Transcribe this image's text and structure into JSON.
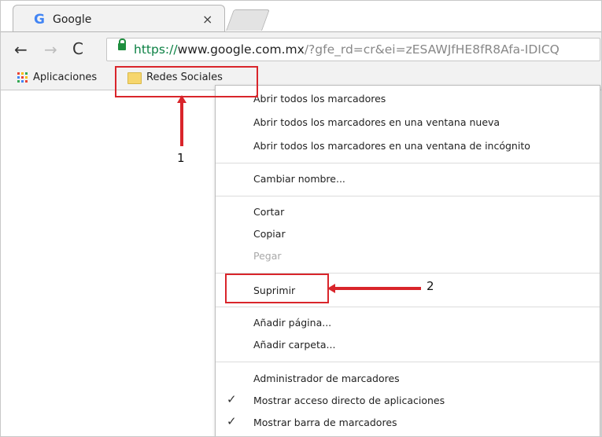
{
  "tab": {
    "icon": "google-g-icon",
    "icon_glyph": "G",
    "title": "Google",
    "close": "×"
  },
  "toolbar": {
    "back": "←",
    "forward": "→",
    "reload": "C",
    "url_scheme": "https://",
    "url_host": "www.google.com.mx",
    "url_rest": "/?gfe_rd=cr&ei=zESAWJfHE8fR8Afa-IDICQ"
  },
  "bookmarks": {
    "apps_label": "Aplicaciones",
    "folder_label": "Redes Sociales"
  },
  "menu": {
    "open_all": "Abrir todos los marcadores",
    "open_all_new_window": "Abrir todos los marcadores en una ventana nueva",
    "open_all_incognito": "Abrir todos los marcadores en una ventana de incógnito",
    "rename": "Cambiar nombre...",
    "cut": "Cortar",
    "copy": "Copiar",
    "paste": "Pegar",
    "delete": "Suprimir",
    "add_page": "Añadir página...",
    "add_folder": "Añadir carpeta...",
    "bookmark_manager": "Administrador de marcadores",
    "show_apps_shortcut": "Mostrar acceso directo de aplicaciones",
    "show_bookmarks_bar": "Mostrar barra de marcadores",
    "check": "✓"
  },
  "annotations": {
    "label_1": "1",
    "label_2": "2"
  },
  "colors": {
    "accent": "#d9252b",
    "secure": "#0b8043",
    "folder": "#f6d66d"
  }
}
